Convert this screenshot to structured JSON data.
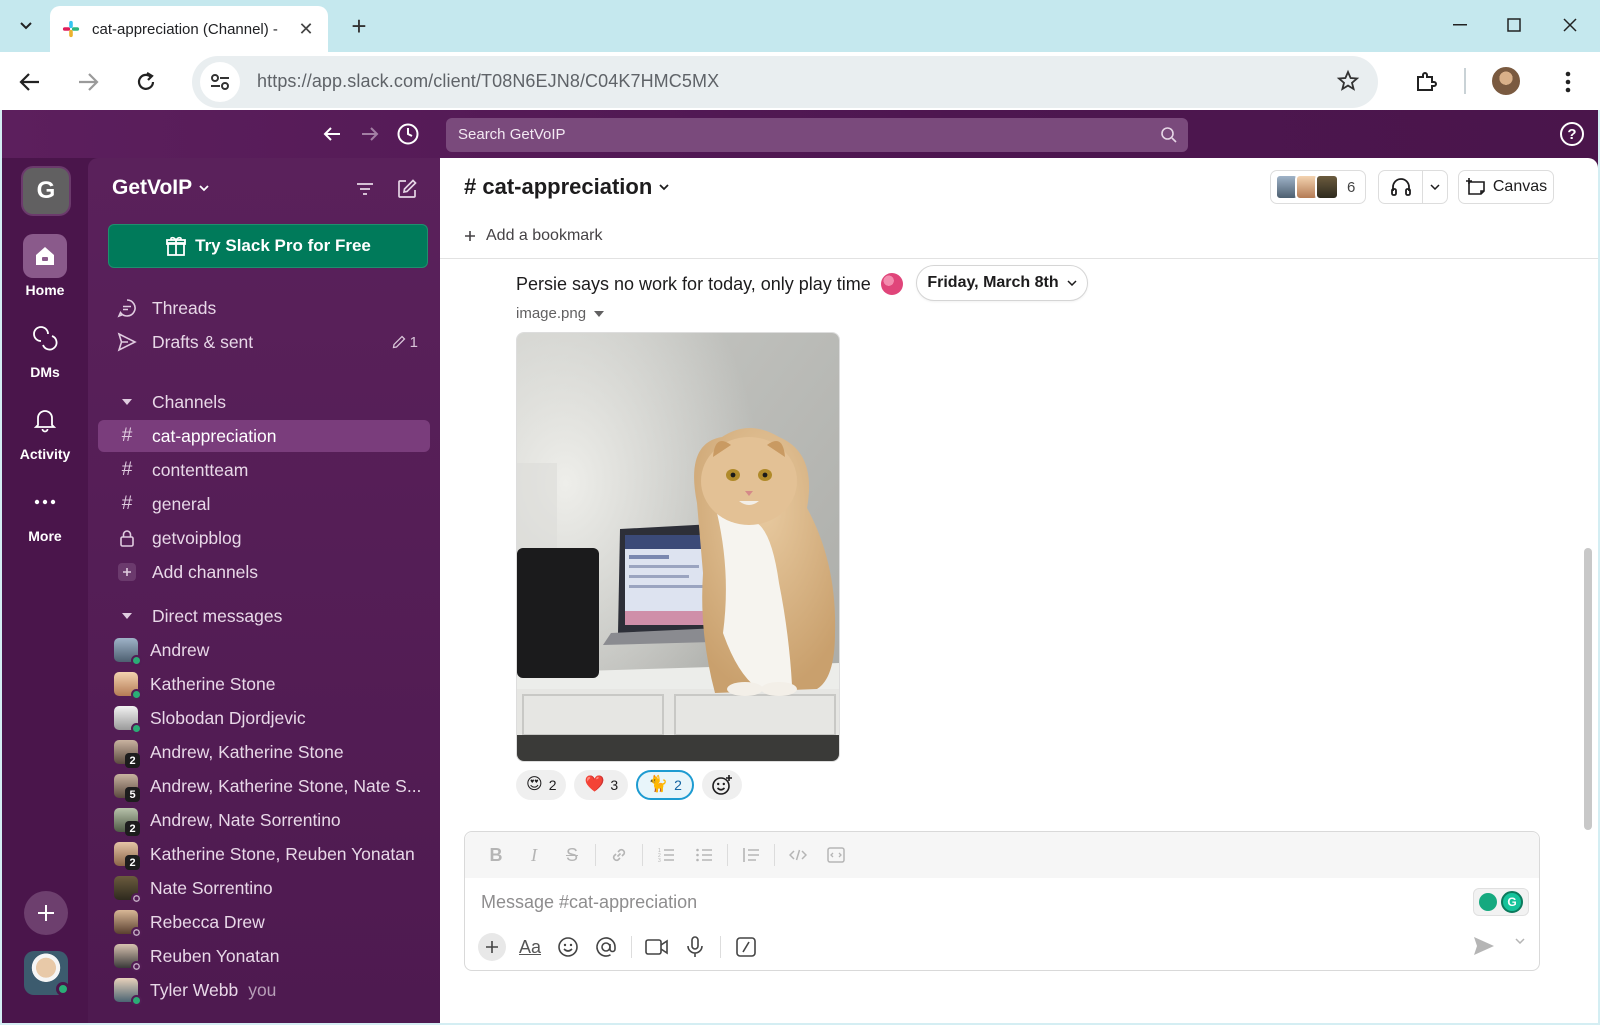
{
  "browser": {
    "tab_title": "cat-appreciation (Channel) -",
    "url": "https://app.slack.com/client/T08N6EJN8/C04K7HMC5MX"
  },
  "slack": {
    "search_placeholder": "Search GetVoIP",
    "rail": {
      "workspace_initial": "G",
      "items": [
        {
          "label": "Home",
          "icon": "home-icon",
          "active": true
        },
        {
          "label": "DMs",
          "icon": "dm-icon"
        },
        {
          "label": "Activity",
          "icon": "bell-icon"
        },
        {
          "label": "More",
          "icon": "more-icon"
        }
      ]
    },
    "sidebar": {
      "workspace_name": "GetVoIP",
      "pro_button": "Try Slack Pro for Free",
      "threads": "Threads",
      "drafts": "Drafts & sent",
      "drafts_count": "1",
      "channels_header": "Channels",
      "channels": [
        {
          "name": "cat-appreciation",
          "icon": "hash-icon",
          "active": true
        },
        {
          "name": "contentteam",
          "icon": "hash-icon"
        },
        {
          "name": "general",
          "icon": "hash-icon"
        },
        {
          "name": "getvoipblog",
          "icon": "lock-icon"
        }
      ],
      "add_channels": "Add channels",
      "dm_header": "Direct messages",
      "dms": [
        {
          "name": "Andrew",
          "status": "on"
        },
        {
          "name": "Katherine Stone",
          "status": "on"
        },
        {
          "name": "Slobodan Djordjevic",
          "status": "on"
        },
        {
          "name": "Andrew, Katherine Stone",
          "count": "2"
        },
        {
          "name": "Andrew, Katherine Stone, Nate S...",
          "count": "5"
        },
        {
          "name": "Andrew, Nate Sorrentino",
          "count": "2"
        },
        {
          "name": "Katherine Stone, Reuben Yonatan",
          "count": "2"
        },
        {
          "name": "Nate Sorrentino",
          "status": "off"
        },
        {
          "name": "Rebecca Drew",
          "status": "off"
        },
        {
          "name": "Reuben Yonatan",
          "status": "off"
        },
        {
          "name": "Tyler Webb",
          "status": "on",
          "you": "you"
        }
      ]
    },
    "channel": {
      "title": "# cat-appreciation",
      "member_count": "6",
      "canvas_label": "Canvas",
      "bookmark_label": "Add a bookmark"
    },
    "message": {
      "text": "Persie says no work for today, only play time",
      "date_pill": "Friday, March 8th",
      "file_name": "image.png",
      "reactions": [
        {
          "emoji": "😍",
          "count": "2",
          "mine": false
        },
        {
          "emoji": "❤️",
          "count": "3",
          "mine": false
        },
        {
          "emoji": "🐈",
          "count": "2",
          "mine": true
        }
      ]
    },
    "composer": {
      "placeholder": "Message #cat-appreciation"
    }
  },
  "colors": {
    "aubergine": "#4a154b",
    "active_channel": "#7a3d7c",
    "pro_green": "#007a5a",
    "online": "#2bac76"
  }
}
